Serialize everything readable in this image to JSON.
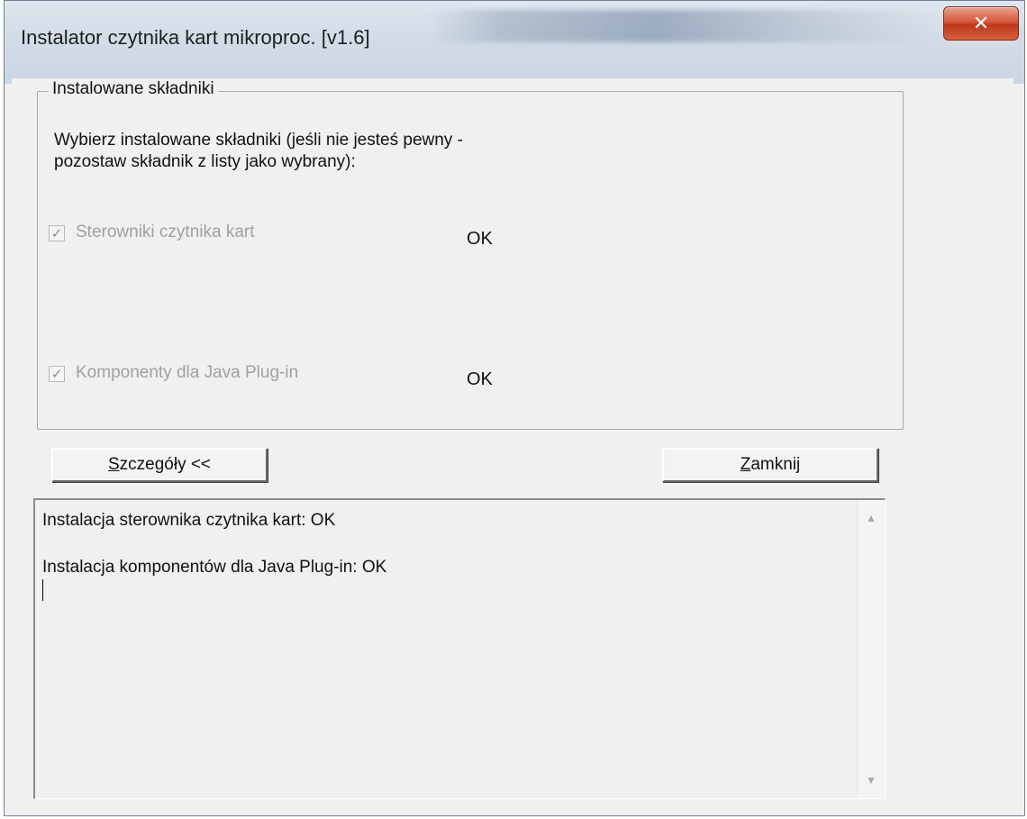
{
  "window": {
    "title": "Instalator czytnika kart mikroproc. [v1.6]",
    "close_glyph": "✕"
  },
  "group": {
    "legend": "Instalowane składniki",
    "instructions_line1": "Wybierz instalowane składniki (jeśli nie jesteś pewny -",
    "instructions_line2": "pozostaw składnik z listy jako wybrany):",
    "items": [
      {
        "label": "Sterowniki czytnika kart",
        "checked": true,
        "enabled": false,
        "status": "OK"
      },
      {
        "label": "Komponenty dla Java Plug-in",
        "checked": true,
        "enabled": false,
        "status": "OK"
      }
    ]
  },
  "buttons": {
    "details_label_accel": "S",
    "details_label_rest": "zczegóły <<",
    "close_label_accel": "Z",
    "close_label_rest": "amknij"
  },
  "log": {
    "lines": [
      "Instalacja sterownika czytnika kart: OK",
      "",
      "Instalacja komponentów dla Java Plug-in: OK"
    ]
  },
  "icons": {
    "close": "close-icon",
    "checkbox": "checkmark-icon",
    "scroll_up": "scroll-up-arrow-icon",
    "scroll_down": "scroll-down-arrow-icon"
  },
  "colors": {
    "close_button": "#d9563a",
    "dialog_background": "#f0f0f0",
    "disabled_text": "#a0a0a0"
  }
}
